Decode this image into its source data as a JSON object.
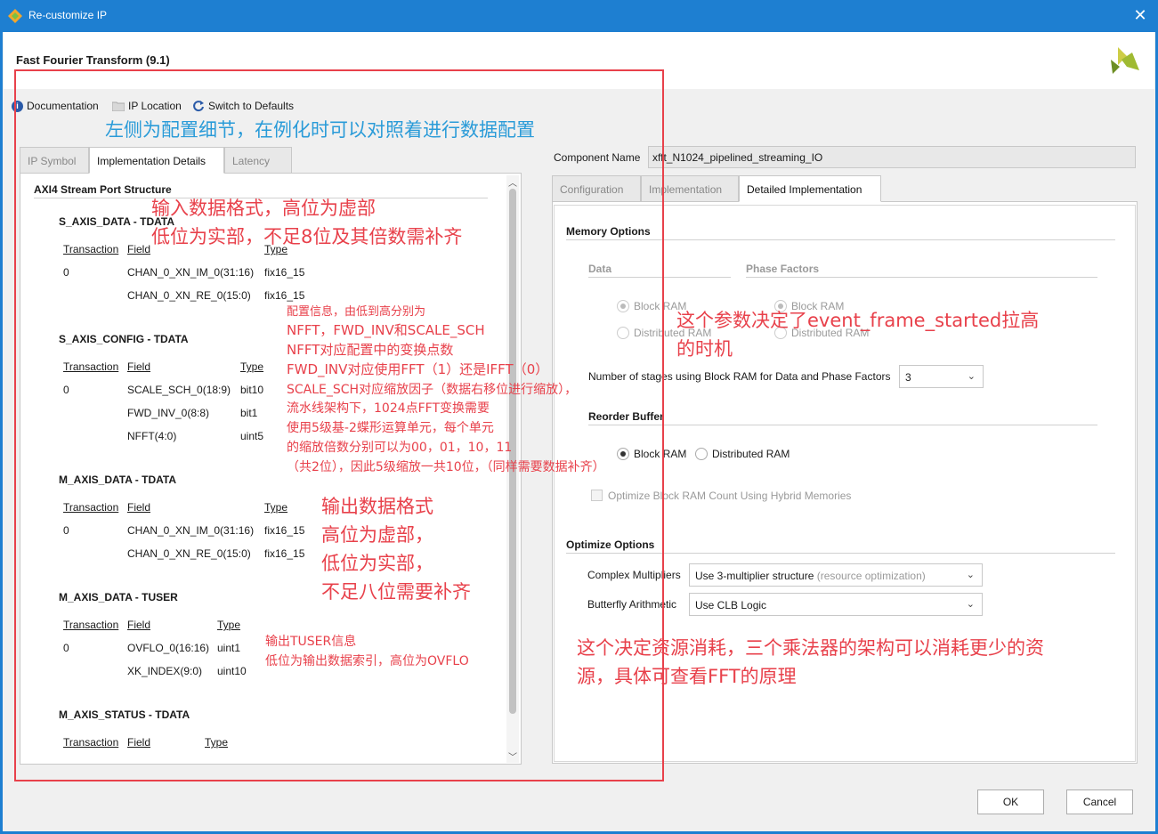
{
  "window": {
    "title": "Re-customize IP",
    "close_glyph": "✕"
  },
  "ip": {
    "title": "Fast Fourier Transform (9.1)"
  },
  "toolbar": {
    "documentation": "Documentation",
    "ip_location": "IP Location",
    "switch_defaults": "Switch to Defaults"
  },
  "left_tabs": [
    "IP Symbol",
    "Implementation Details",
    "Latency"
  ],
  "left": {
    "section_title": "AXI4 Stream Port Structure",
    "groups": [
      {
        "title": "S_AXIS_DATA - TDATA",
        "headers": [
          "Transaction",
          "Field",
          "Type"
        ],
        "rows": [
          [
            "0",
            "CHAN_0_XN_IM_0(31:16)",
            "fix16_15"
          ],
          [
            "",
            "CHAN_0_XN_RE_0(15:0)",
            "fix16_15"
          ]
        ]
      },
      {
        "title": "S_AXIS_CONFIG - TDATA",
        "headers": [
          "Transaction",
          "Field",
          "Type"
        ],
        "rows": [
          [
            "0",
            "SCALE_SCH_0(18:9)",
            "bit10"
          ],
          [
            "",
            "FWD_INV_0(8:8)",
            "bit1"
          ],
          [
            "",
            "NFFT(4:0)",
            "uint5"
          ]
        ]
      },
      {
        "title": "M_AXIS_DATA - TDATA",
        "headers": [
          "Transaction",
          "Field",
          "Type"
        ],
        "rows": [
          [
            "0",
            "CHAN_0_XN_IM_0(31:16)",
            "fix16_15"
          ],
          [
            "",
            "CHAN_0_XN_RE_0(15:0)",
            "fix16_15"
          ]
        ]
      },
      {
        "title": "M_AXIS_DATA - TUSER",
        "headers": [
          "Transaction",
          "Field",
          "Type"
        ],
        "rows": [
          [
            "0",
            "OVFLO_0(16:16)",
            "uint1"
          ],
          [
            "",
            "XK_INDEX(9:0)",
            "uint10"
          ]
        ]
      },
      {
        "title": "M_AXIS_STATUS - TDATA",
        "headers": [
          "Transaction",
          "Field",
          "Type"
        ],
        "rows": []
      }
    ]
  },
  "component": {
    "label": "Component Name",
    "value": "xfft_N1024_pipelined_streaming_IO"
  },
  "right_tabs": [
    "Configuration",
    "Implementation",
    "Detailed Implementation"
  ],
  "right": {
    "memory_options": "Memory Options",
    "data_label": "Data",
    "phase_label": "Phase Factors",
    "block_ram": "Block RAM",
    "distributed_ram": "Distributed RAM",
    "stages_label": "Number of stages using Block RAM for Data and Phase Factors",
    "stages_value": "3",
    "reorder_buffer": "Reorder Buffer",
    "optimize_hybrid": "Optimize Block RAM Count Using Hybrid Memories",
    "optimize_options": "Optimize Options",
    "complex_mult_label": "Complex Multipliers",
    "complex_mult_value": "Use 3-multiplier structure",
    "complex_mult_hint": "(resource optimization)",
    "butterfly_label": "Butterfly Arithmetic",
    "butterfly_value": "Use CLB Logic"
  },
  "buttons": {
    "ok": "OK",
    "cancel": "Cancel"
  },
  "annotations": {
    "left_note": "左侧为配置细节，在例化时可以对照着进行数据配置",
    "input_fmt_1": "输入数据格式，高位为虚部",
    "input_fmt_2": "低位为实部，不足8位及其倍数需补齐",
    "config_lines": [
      "配置信息，由低到高分别为",
      "NFFT，FWD_INV和SCALE_SCH",
      "NFFT对应配置中的变换点数",
      "FWD_INV对应使用FFT（1）还是IFFT（0）",
      "SCALE_SCH对应缩放因子（数据右移位进行缩放），",
      "流水线架构下，1024点FFT变换需要",
      "使用5级基-2蝶形运算单元，每个单元",
      "的缩放倍数分别可以为00，01，10，11",
      "（共2位），因此5级缩放一共10位，（同样需要数据补齐）"
    ],
    "output_lines": [
      "输出数据格式",
      "高位为虚部，",
      "低位为实部，",
      "不足八位需要补齐"
    ],
    "tuser_lines": [
      "输出TUSER信息",
      "低位为输出数据索引，高位为OVFLO"
    ],
    "stages_note_1": "这个参数决定了event_frame_started拉高",
    "stages_note_2": "的时机",
    "mult_note_1": "这个决定资源消耗，三个乘法器的架构可以消耗更少的资",
    "mult_note_2": "源，具体可查看FFT的原理"
  },
  "colors": {
    "titlebar": "#1e7fd1",
    "annotation_red": "#e8414b",
    "annotation_blue": "#2a9bd8"
  }
}
